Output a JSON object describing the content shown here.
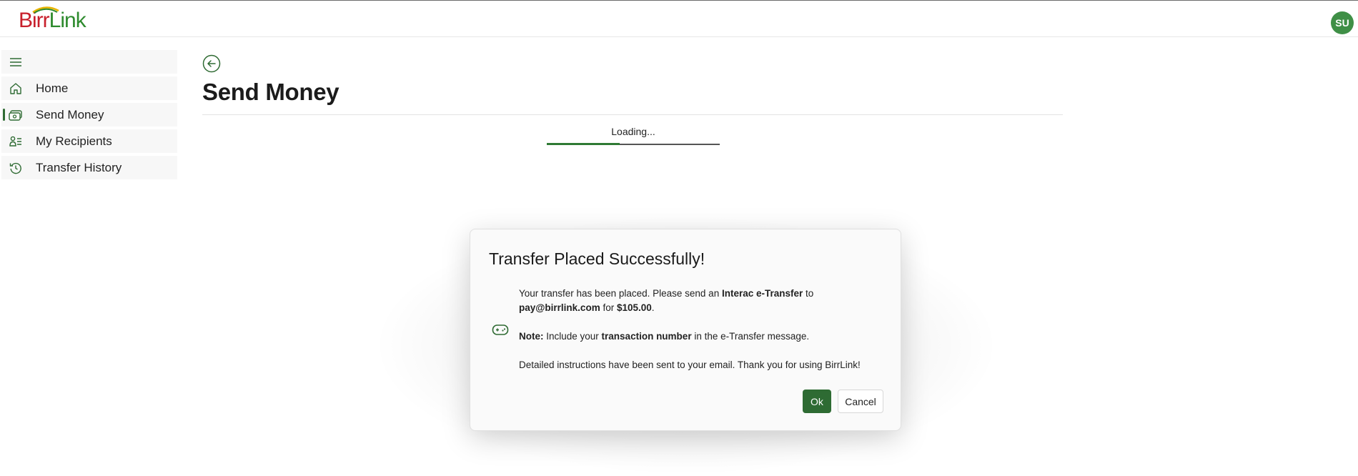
{
  "header": {
    "logo_birr": "Birr",
    "logo_link": "Link",
    "avatar_initials": "SU"
  },
  "sidebar": {
    "items": [
      {
        "label": "Home",
        "icon": "home-icon"
      },
      {
        "label": "Send Money",
        "icon": "money-icon",
        "active": true
      },
      {
        "label": "My Recipients",
        "icon": "recipients-icon"
      },
      {
        "label": "Transfer History",
        "icon": "history-icon"
      }
    ]
  },
  "main": {
    "title": "Send Money",
    "loading_text": "Loading...",
    "loading_progress": 0.42
  },
  "dialog": {
    "title": "Transfer Placed Successfully!",
    "line1_pre": "Your transfer has been placed. Please send an ",
    "line1_bold": "Interac e-Transfer",
    "line1_post": " to",
    "email": "pay@birrlink.com",
    "for_text": " for ",
    "amount": "$105.00",
    "period": ".",
    "note_label": "Note:",
    "note_pre": " Include your ",
    "note_bold": "transaction number",
    "note_post": " in the e-Transfer message.",
    "closing": "Detailed instructions have been sent to your email. Thank you for using BirrLink!",
    "ok_label": "Ok",
    "cancel_label": "Cancel"
  },
  "colors": {
    "brand_green": "#2e6b33",
    "brand_red": "#c8202c",
    "avatar_bg": "#3f8f46"
  }
}
